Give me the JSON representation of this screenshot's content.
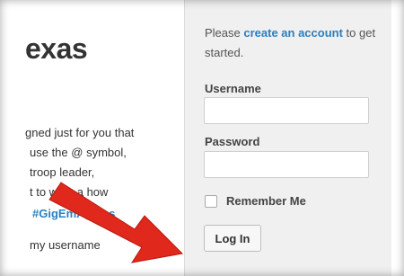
{
  "site": {
    "title_fragment": "exas",
    "body_lines": [
      "gned just for you that",
      "use the @ symbol,",
      "troop leader,",
      "t to write a      how",
      "my username"
    ],
    "hashtag": "#GigEmAggies"
  },
  "login": {
    "intro_before": "Please ",
    "intro_link": "create an account",
    "intro_after": " to get started.",
    "username_label": "Username",
    "username_value": "",
    "password_label": "Password",
    "password_value": "",
    "remember_label": "Remember Me",
    "remember_checked": false,
    "submit_label": "Log In"
  },
  "annotation": {
    "arrow_color": "#e0281c",
    "arrow_target": "login-button"
  }
}
